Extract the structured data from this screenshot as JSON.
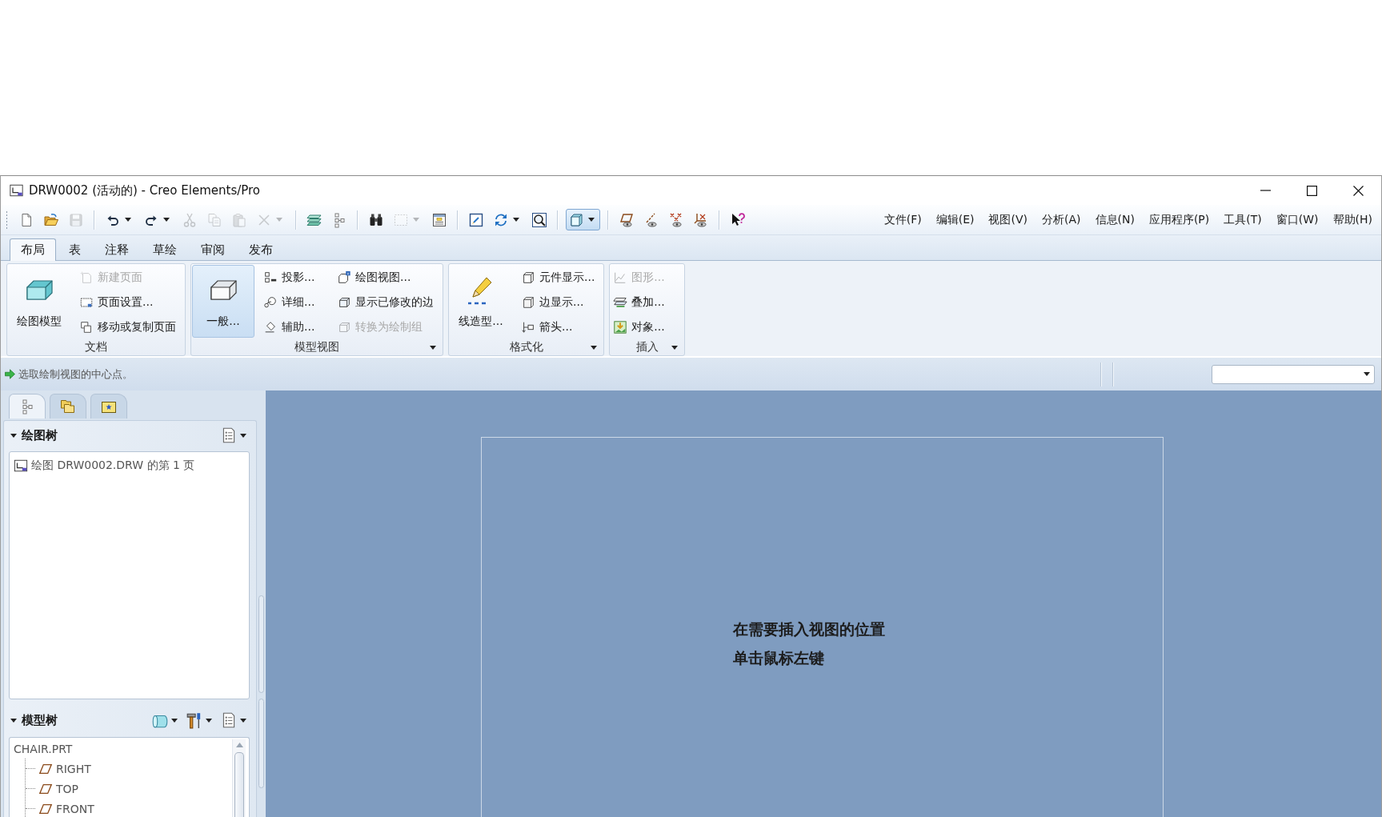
{
  "window": {
    "title": "DRW0002 (活动的) - Creo Elements/Pro"
  },
  "toolbar": [
    {
      "items": [
        {
          "kind": "new",
          "disabled": false,
          "dropdown": false,
          "pressed": false
        },
        {
          "kind": "open",
          "disabled": false,
          "dropdown": false,
          "pressed": false
        },
        {
          "kind": "save",
          "disabled": true,
          "dropdown": false,
          "pressed": false
        }
      ]
    },
    {
      "items": [
        {
          "kind": "undo",
          "disabled": false,
          "dropdown": true,
          "pressed": false
        },
        {
          "kind": "redo",
          "disabled": false,
          "dropdown": true,
          "pressed": false
        },
        {
          "kind": "cut",
          "disabled": true,
          "dropdown": false,
          "pressed": false
        },
        {
          "kind": "copy",
          "disabled": true,
          "dropdown": false,
          "pressed": false
        },
        {
          "kind": "paste",
          "disabled": true,
          "dropdown": false,
          "pressed": false
        },
        {
          "kind": "delete",
          "disabled": true,
          "dropdown": true,
          "pressed": false
        }
      ]
    },
    {
      "items": [
        {
          "kind": "layers",
          "disabled": false,
          "dropdown": false,
          "pressed": false
        },
        {
          "kind": "tree",
          "disabled": false,
          "dropdown": false,
          "pressed": false
        }
      ]
    },
    {
      "items": [
        {
          "kind": "find",
          "disabled": false,
          "dropdown": false,
          "pressed": false
        },
        {
          "kind": "select",
          "disabled": true,
          "dropdown": true,
          "pressed": false
        },
        {
          "kind": "table",
          "disabled": false,
          "dropdown": false,
          "pressed": false
        }
      ]
    },
    {
      "items": [
        {
          "kind": "repaint",
          "disabled": false,
          "dropdown": false,
          "pressed": false
        },
        {
          "kind": "orient",
          "disabled": false,
          "dropdown": true,
          "pressed": false
        },
        {
          "kind": "zoom",
          "disabled": false,
          "dropdown": false,
          "pressed": false
        }
      ]
    },
    {
      "items": [
        {
          "kind": "display",
          "disabled": false,
          "dropdown": true,
          "pressed": true
        }
      ]
    },
    {
      "items": [
        {
          "kind": "planes",
          "disabled": false,
          "dropdown": false,
          "pressed": false
        },
        {
          "kind": "axes",
          "disabled": false,
          "dropdown": false,
          "pressed": false
        },
        {
          "kind": "points",
          "disabled": false,
          "dropdown": false,
          "pressed": false
        },
        {
          "kind": "csys",
          "disabled": false,
          "dropdown": false,
          "pressed": false
        }
      ]
    },
    {
      "items": [
        {
          "kind": "help",
          "disabled": false,
          "dropdown": false,
          "pressed": false
        }
      ]
    }
  ],
  "menu": [
    "文件(F)",
    "编辑(E)",
    "视图(V)",
    "分析(A)",
    "信息(N)",
    "应用程序(P)",
    "工具(T)",
    "窗口(W)",
    "帮助(H)"
  ],
  "tabs": [
    {
      "label": "布局",
      "selected": true
    },
    {
      "label": "表",
      "selected": false
    },
    {
      "label": "注释",
      "selected": false
    },
    {
      "label": "草绘",
      "selected": false
    },
    {
      "label": "审阅",
      "selected": false
    },
    {
      "label": "发布",
      "selected": false
    }
  ],
  "ribbon": {
    "groups": [
      {
        "label": "文档",
        "launcher": false,
        "large": {
          "label": "绘图模型",
          "kind": "model",
          "pressed": false
        },
        "columns": [
          {
            "items": [
              {
                "label": "新建页面",
                "kind": "newpage",
                "disabled": true
              },
              {
                "label": "页面设置...",
                "kind": "pagesetup",
                "disabled": false
              },
              {
                "label": "移动或复制页面",
                "kind": "movepage",
                "disabled": false
              }
            ]
          }
        ]
      },
      {
        "label": "模型视图",
        "launcher": true,
        "large": {
          "label": "一般...",
          "kind": "general",
          "pressed": true
        },
        "columns": [
          {
            "items": [
              {
                "label": "投影...",
                "kind": "projection",
                "disabled": false
              },
              {
                "label": "详细...",
                "kind": "detail",
                "disabled": false
              },
              {
                "label": "辅助...",
                "kind": "auxiliary",
                "disabled": false
              }
            ]
          },
          {
            "items": [
              {
                "label": "绘图视图...",
                "kind": "drawingview",
                "disabled": false
              },
              {
                "label": "显示已修改的边",
                "kind": "modedges",
                "disabled": false
              },
              {
                "label": "转换为绘制组",
                "kind": "convert",
                "disabled": true
              }
            ]
          }
        ]
      },
      {
        "label": "格式化",
        "launcher": true,
        "large": {
          "label": "线造型...",
          "kind": "linestyle",
          "pressed": false
        },
        "columns": [
          {
            "items": [
              {
                "label": "元件显示...",
                "kind": "component",
                "disabled": false
              },
              {
                "label": "边显示...",
                "kind": "edge",
                "disabled": false
              },
              {
                "label": "箭头...",
                "kind": "arrow",
                "disabled": false
              }
            ]
          }
        ]
      },
      {
        "label": "插入",
        "launcher": true,
        "columns": [
          {
            "items": [
              {
                "label": "图形...",
                "kind": "graph",
                "disabled": true
              },
              {
                "label": "叠加...",
                "kind": "overlay",
                "disabled": false
              },
              {
                "label": "对象...",
                "kind": "object",
                "disabled": false
              }
            ]
          }
        ]
      }
    ]
  },
  "message": {
    "text": "选取绘制视图的中心点。"
  },
  "navigator": {
    "tabs": [
      {
        "kind": "tree",
        "selected": true
      },
      {
        "kind": "layers",
        "selected": false
      },
      {
        "kind": "favorites",
        "selected": false
      }
    ],
    "drawing_tree": {
      "title": "绘图树",
      "expanded": true,
      "items": [
        {
          "label": "绘图 DRW0002.DRW 的第 1 页",
          "kind": "sheet"
        }
      ]
    },
    "model_tree": {
      "title": "模型树",
      "expanded": true,
      "items": [
        {
          "label": "CHAIR.PRT",
          "children": [
            {
              "label": "RIGHT",
              "kind": "plane"
            },
            {
              "label": "TOP",
              "kind": "plane"
            },
            {
              "label": "FRONT",
              "kind": "plane"
            }
          ]
        }
      ]
    }
  },
  "canvas": {
    "hint_lines": [
      "在需要插入视图的位置",
      "单击鼠标左键"
    ]
  }
}
